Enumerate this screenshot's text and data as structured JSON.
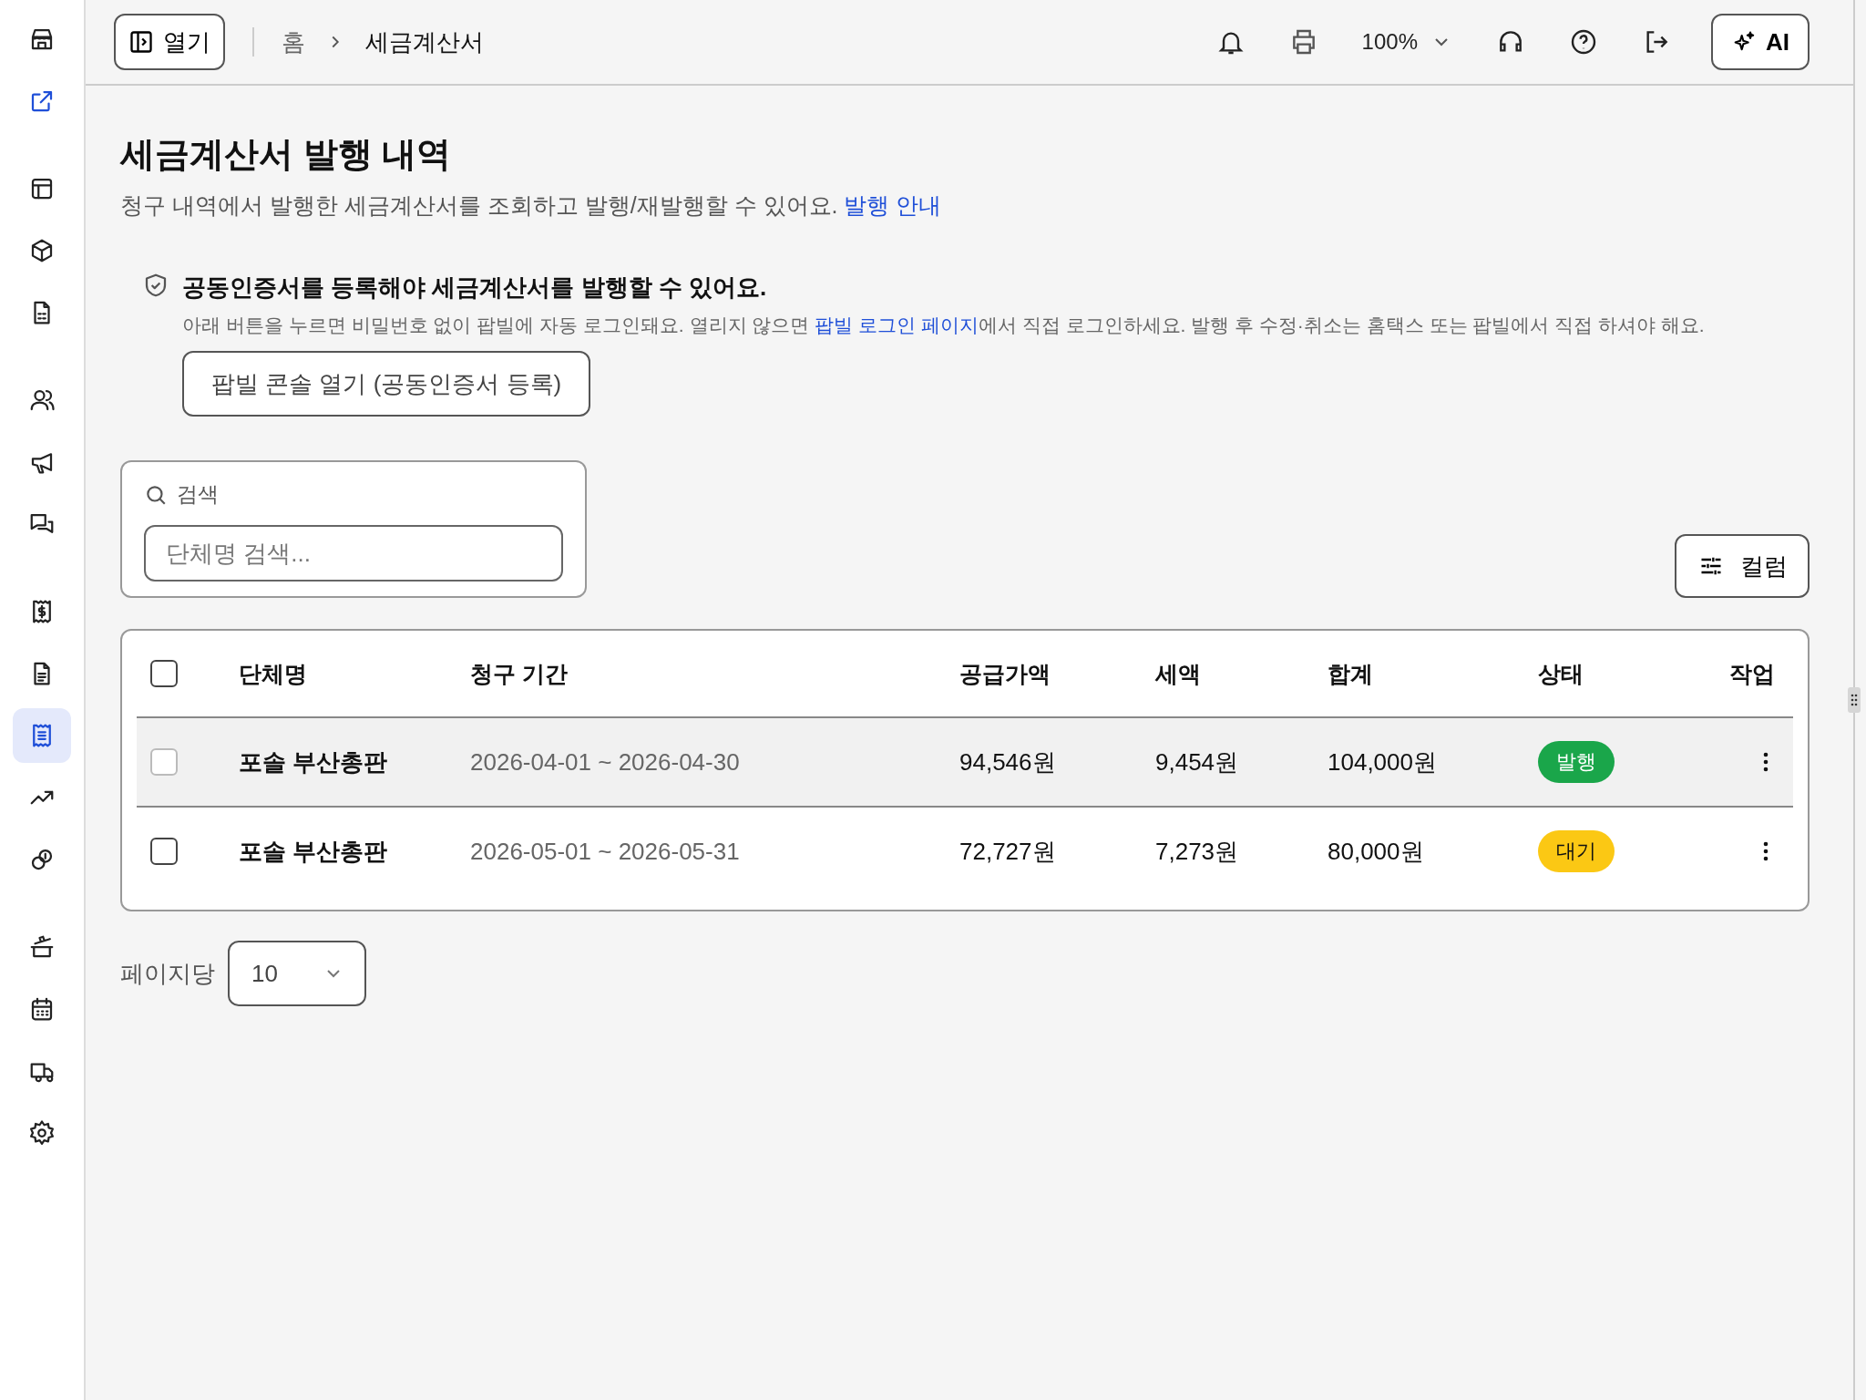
{
  "sidebar": {
    "groups": [
      [
        {
          "selected": false
        },
        {
          "selected": false,
          "kind": "link"
        }
      ],
      [
        {
          "selected": false
        },
        {
          "selected": false
        },
        {
          "selected": false
        }
      ],
      [
        {
          "selected": false
        },
        {
          "selected": false
        },
        {
          "selected": false
        }
      ],
      [
        {
          "selected": false
        },
        {
          "selected": false
        },
        {
          "selected": true
        },
        {
          "selected": false
        },
        {
          "selected": false
        }
      ],
      [
        {
          "selected": false
        },
        {
          "selected": false
        },
        {
          "selected": false
        },
        {
          "selected": false
        }
      ]
    ]
  },
  "topbar": {
    "open_button": "열기",
    "breadcrumb": [
      "홈",
      "세금계산서"
    ],
    "zoom": "100%",
    "ai_button": "AI"
  },
  "page": {
    "title": "세금계산서 발행 내역",
    "subtitle": "청구 내역에서 발행한 세금계산서를 조회하고 발행/재발행할 수 있어요.",
    "subtitle_link": "발행 안내"
  },
  "notice": {
    "title": "공동인증서를 등록해야 세금계산서를 발행할 수 있어요.",
    "text_before": "아래 버튼을 누르면 비밀번호 없이 팝빌에 자동 로그인돼요. 열리지 않으면 ",
    "link": "팝빌 로그인 페이지",
    "text_after": "에서 직접 로그인하세요. 발행 후 수정·취소는 홈택스 또는 팝빌에서 직접 하셔야 해요.",
    "button": "팝빌 콘솔 열기 (공동인증서 등록)"
  },
  "search": {
    "label": "검색",
    "placeholder": "단체명 검색..."
  },
  "columns_button": "컬럼",
  "table": {
    "select_all": {
      "checked": false
    },
    "columns": [
      "단체명",
      "청구 기간",
      "공급가액",
      "세액",
      "합계",
      "상태",
      "작업"
    ],
    "rows": [
      {
        "checked": false,
        "disabled": true,
        "highlighted": true,
        "cells": [
          "포솔 부산총판",
          "2026-04-01 ~ 2026-04-30",
          "94,546원",
          "9,454원",
          "104,000원"
        ],
        "status": {
          "label": "발행",
          "kind": "issued"
        }
      },
      {
        "checked": false,
        "disabled": false,
        "highlighted": false,
        "cells": [
          "포솔 부산총판",
          "2026-05-01 ~ 2026-05-31",
          "72,727원",
          "7,273원",
          "80,000원"
        ],
        "status": {
          "label": "대기",
          "kind": "pending"
        }
      }
    ]
  },
  "pagination": {
    "label": "페이지당",
    "page_size": "10"
  }
}
